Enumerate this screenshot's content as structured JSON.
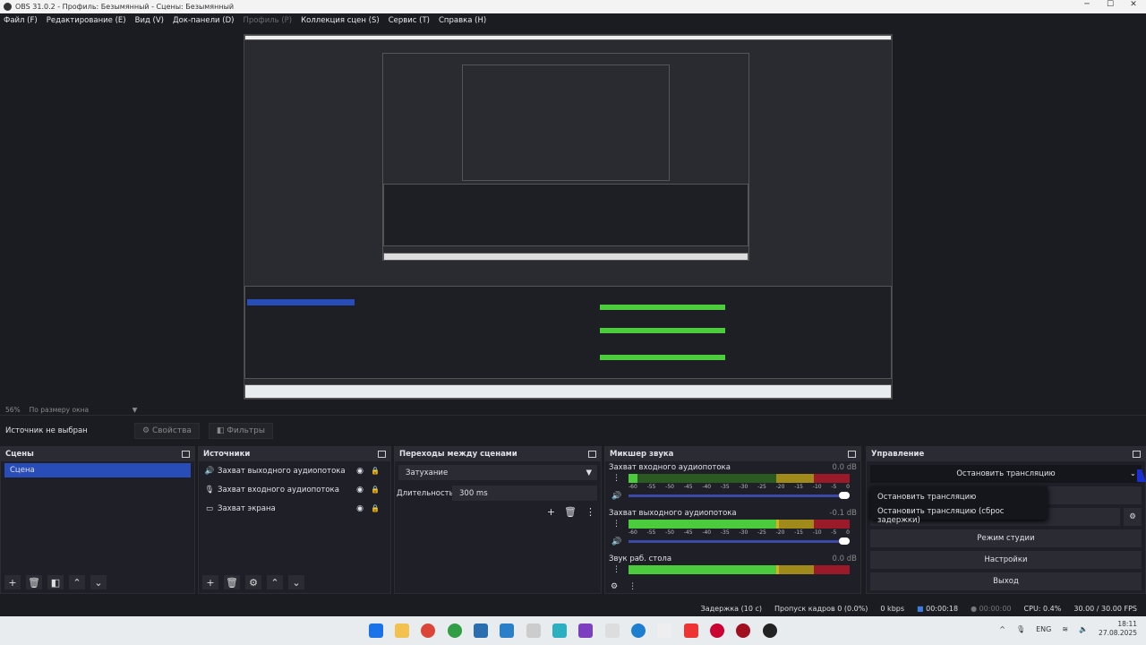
{
  "window": {
    "title": "OBS 31.0.2 - Профиль: Безымянный - Сцены: Безымянный",
    "minimize": "─",
    "maximize": "☐",
    "close": "✕"
  },
  "menu": [
    "Файл (F)",
    "Редактирование (E)",
    "Вид (V)",
    "Док-панели (D)",
    "Профиль (P)",
    "Коллекция сцен (S)",
    "Сервис (T)",
    "Справка (H)"
  ],
  "preview": {
    "zoom": "56%",
    "scale_mode": "По размеру окна"
  },
  "source_toolbar": {
    "status": "Источник не выбран",
    "properties": "Свойства",
    "filters": "Фильтры"
  },
  "scenes": {
    "title": "Сцены",
    "items": [
      "Сцена"
    ],
    "selected": 0
  },
  "sources": {
    "title": "Источники",
    "items": [
      {
        "icon": "speaker-icon",
        "name": "Захват выходного аудиопотока"
      },
      {
        "icon": "microphone-icon",
        "name": "Захват входного аудиопотока"
      },
      {
        "icon": "monitor-icon",
        "name": "Захват экрана"
      }
    ]
  },
  "transitions": {
    "title": "Переходы между сценами",
    "selected": "Затухание",
    "duration_label": "Длительность",
    "duration_value": "300 ms"
  },
  "mixer": {
    "title": "Микшер звука",
    "ticks": [
      "-60",
      "-55",
      "-50",
      "-45",
      "-40",
      "-35",
      "-30",
      "-25",
      "-20",
      "-15",
      "-10",
      "-5",
      "0"
    ],
    "tracks": [
      {
        "name": "Захват входного аудиопотока",
        "db": "0.0 dB",
        "level": 0.04
      },
      {
        "name": "Захват выходного аудиопотока",
        "db": "-0.1 dB",
        "level": 0.68
      },
      {
        "name": "Звук раб. стола",
        "db": "0.0 dB",
        "level": 0.68
      }
    ]
  },
  "controls": {
    "title": "Управление",
    "stream_button": "Остановить трансляцию",
    "dropdown": [
      "Остановить трансляцию",
      "Остановить трансляцию (сброс задержки)"
    ],
    "studio_mode": "Режим студии",
    "settings": "Настройки",
    "exit": "Выход"
  },
  "status": {
    "delay": "Задержка (10 с)",
    "dropped": "Пропуск кадров 0 (0.0%)",
    "bitrate": "0 kbps",
    "stream_time": "00:00:18",
    "record_time": "00:00:00",
    "cpu": "CPU: 0.4%",
    "fps": "30.00 / 30.00 FPS"
  },
  "taskbar": {
    "lang": "ENG",
    "time": "18:11",
    "date": "27.08.2025"
  },
  "colors": {
    "accent": "#284cb8",
    "meter_green": "#4ccc3c",
    "meter_yellow": "#a08a1a",
    "meter_red": "#9a1a2a"
  }
}
